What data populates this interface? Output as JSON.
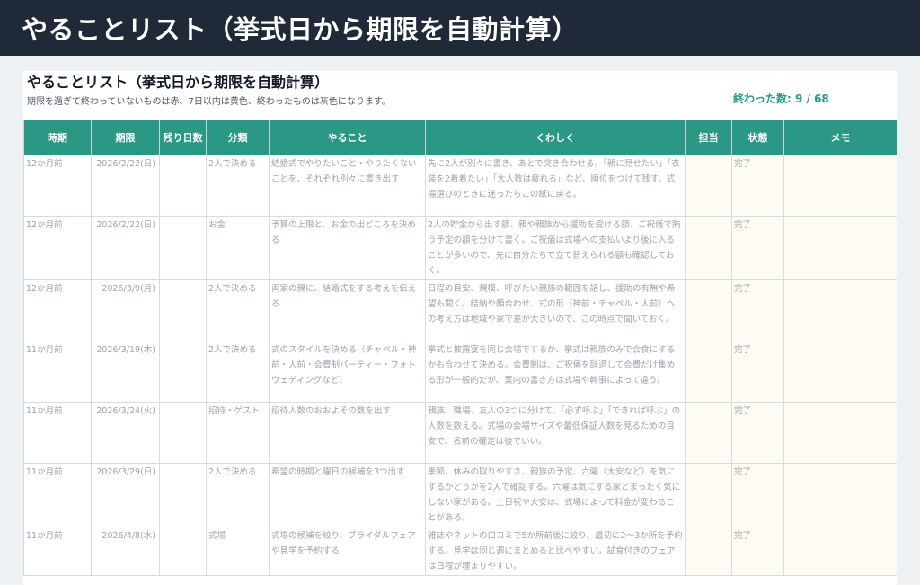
{
  "app": {
    "title": "やることリスト（挙式日から期限を自動計算）"
  },
  "sheet": {
    "title": "やることリスト（挙式日から期限を自動計算）",
    "subtitle": "期限を過ぎて終わっていないものは赤、7日以内は黄色、終わったものは灰色になります。",
    "done_count": "終わった数: 9 / 68"
  },
  "columns": [
    "時期",
    "期限",
    "残り日数",
    "分類",
    "やること",
    "くわしく",
    "担当",
    "状態",
    "メモ"
  ],
  "rows": [
    {
      "period": "12か月前",
      "due": "2026/2/22(日)",
      "remaining": "",
      "category": "2人で決める",
      "task": "結婚式でやりたいこと・やりたくないことを、それぞれ別々に書き出す",
      "detail": "先に2人が別々に書き、あとで突き合わせる。「親に見せたい」「衣装を2着着たい」「大人数は疲れる」など、順位をつけて残す。式場選びのときに迷ったらこの紙に戻る。",
      "assignee": "",
      "status": "完了",
      "memo": ""
    },
    {
      "period": "12か月前",
      "due": "2026/2/22(日)",
      "remaining": "",
      "category": "お金",
      "task": "予算の上限と、お金の出どころを決める",
      "detail": "2人の貯金から出す額、親や親族から援助を受ける額、ご祝儀で賄う予定の額を分けて書く。ご祝儀は式場への支払いより後に入ることが多いので、先に自分たちで立て替えられる額も確認しておく。",
      "assignee": "",
      "status": "完了",
      "memo": ""
    },
    {
      "period": "12か月前",
      "due": "2026/3/9(月)",
      "remaining": "",
      "category": "2人で決める",
      "task": "両家の親に、結婚式をする考えを伝える",
      "detail": "日程の目安、規模、呼びたい親族の範囲を話し、援助の有無や希望も聞く。結納や顔合わせ、式の形（神前・チャペル・人前）への考え方は地域や家で差が大きいので、この時点で聞いておく。",
      "assignee": "",
      "status": "完了",
      "memo": ""
    },
    {
      "period": "11か月前",
      "due": "2026/3/19(木)",
      "remaining": "",
      "category": "2人で決める",
      "task": "式のスタイルを決める（チャペル・神前・人前・会費制パーティー・フォトウェディングなど）",
      "detail": "挙式と披露宴を同じ会場でするか、挙式は親族のみで会食にするかも合わせて決める。会費制は、ご祝儀を辞退して会費だけ集める形が一般的だが、案内の書き方は式場や幹事によって違う。",
      "assignee": "",
      "status": "完了",
      "memo": ""
    },
    {
      "period": "11か月前",
      "due": "2026/3/24(火)",
      "remaining": "",
      "category": "招待・ゲスト",
      "task": "招待人数のおおよその数を出す",
      "detail": "親族、職場、友人の3つに分けて、「必ず呼ぶ」「できれば呼ぶ」の人数を数える。式場の会場サイズや最低保証人数を見るための目安で、名前の確定は後でいい。",
      "assignee": "",
      "status": "完了",
      "memo": ""
    },
    {
      "period": "11か月前",
      "due": "2026/3/29(日)",
      "remaining": "",
      "category": "2人で決める",
      "task": "希望の時期と曜日の候補を3つ出す",
      "detail": "季節、休みの取りやすさ、親族の予定、六曜（大安など）を気にするかどうかを2人で確認する。六曜は気にする家とまったく気にしない家がある。土日祝や大安は、式場によって料金が変わることがある。",
      "assignee": "",
      "status": "完了",
      "memo": ""
    },
    {
      "period": "11か月前",
      "due": "2026/4/8(水)",
      "remaining": "",
      "category": "式場",
      "task": "式場の候補を絞り、ブライダルフェアや見学を予約する",
      "detail": "雑誌やネットの口コミで5か所前後に絞り、最初に2〜3か所を予約する。見学は同じ週にまとめると比べやすい。試食付きのフェアは日程が埋まりやすい。",
      "assignee": "",
      "status": "完了",
      "memo": ""
    }
  ]
}
